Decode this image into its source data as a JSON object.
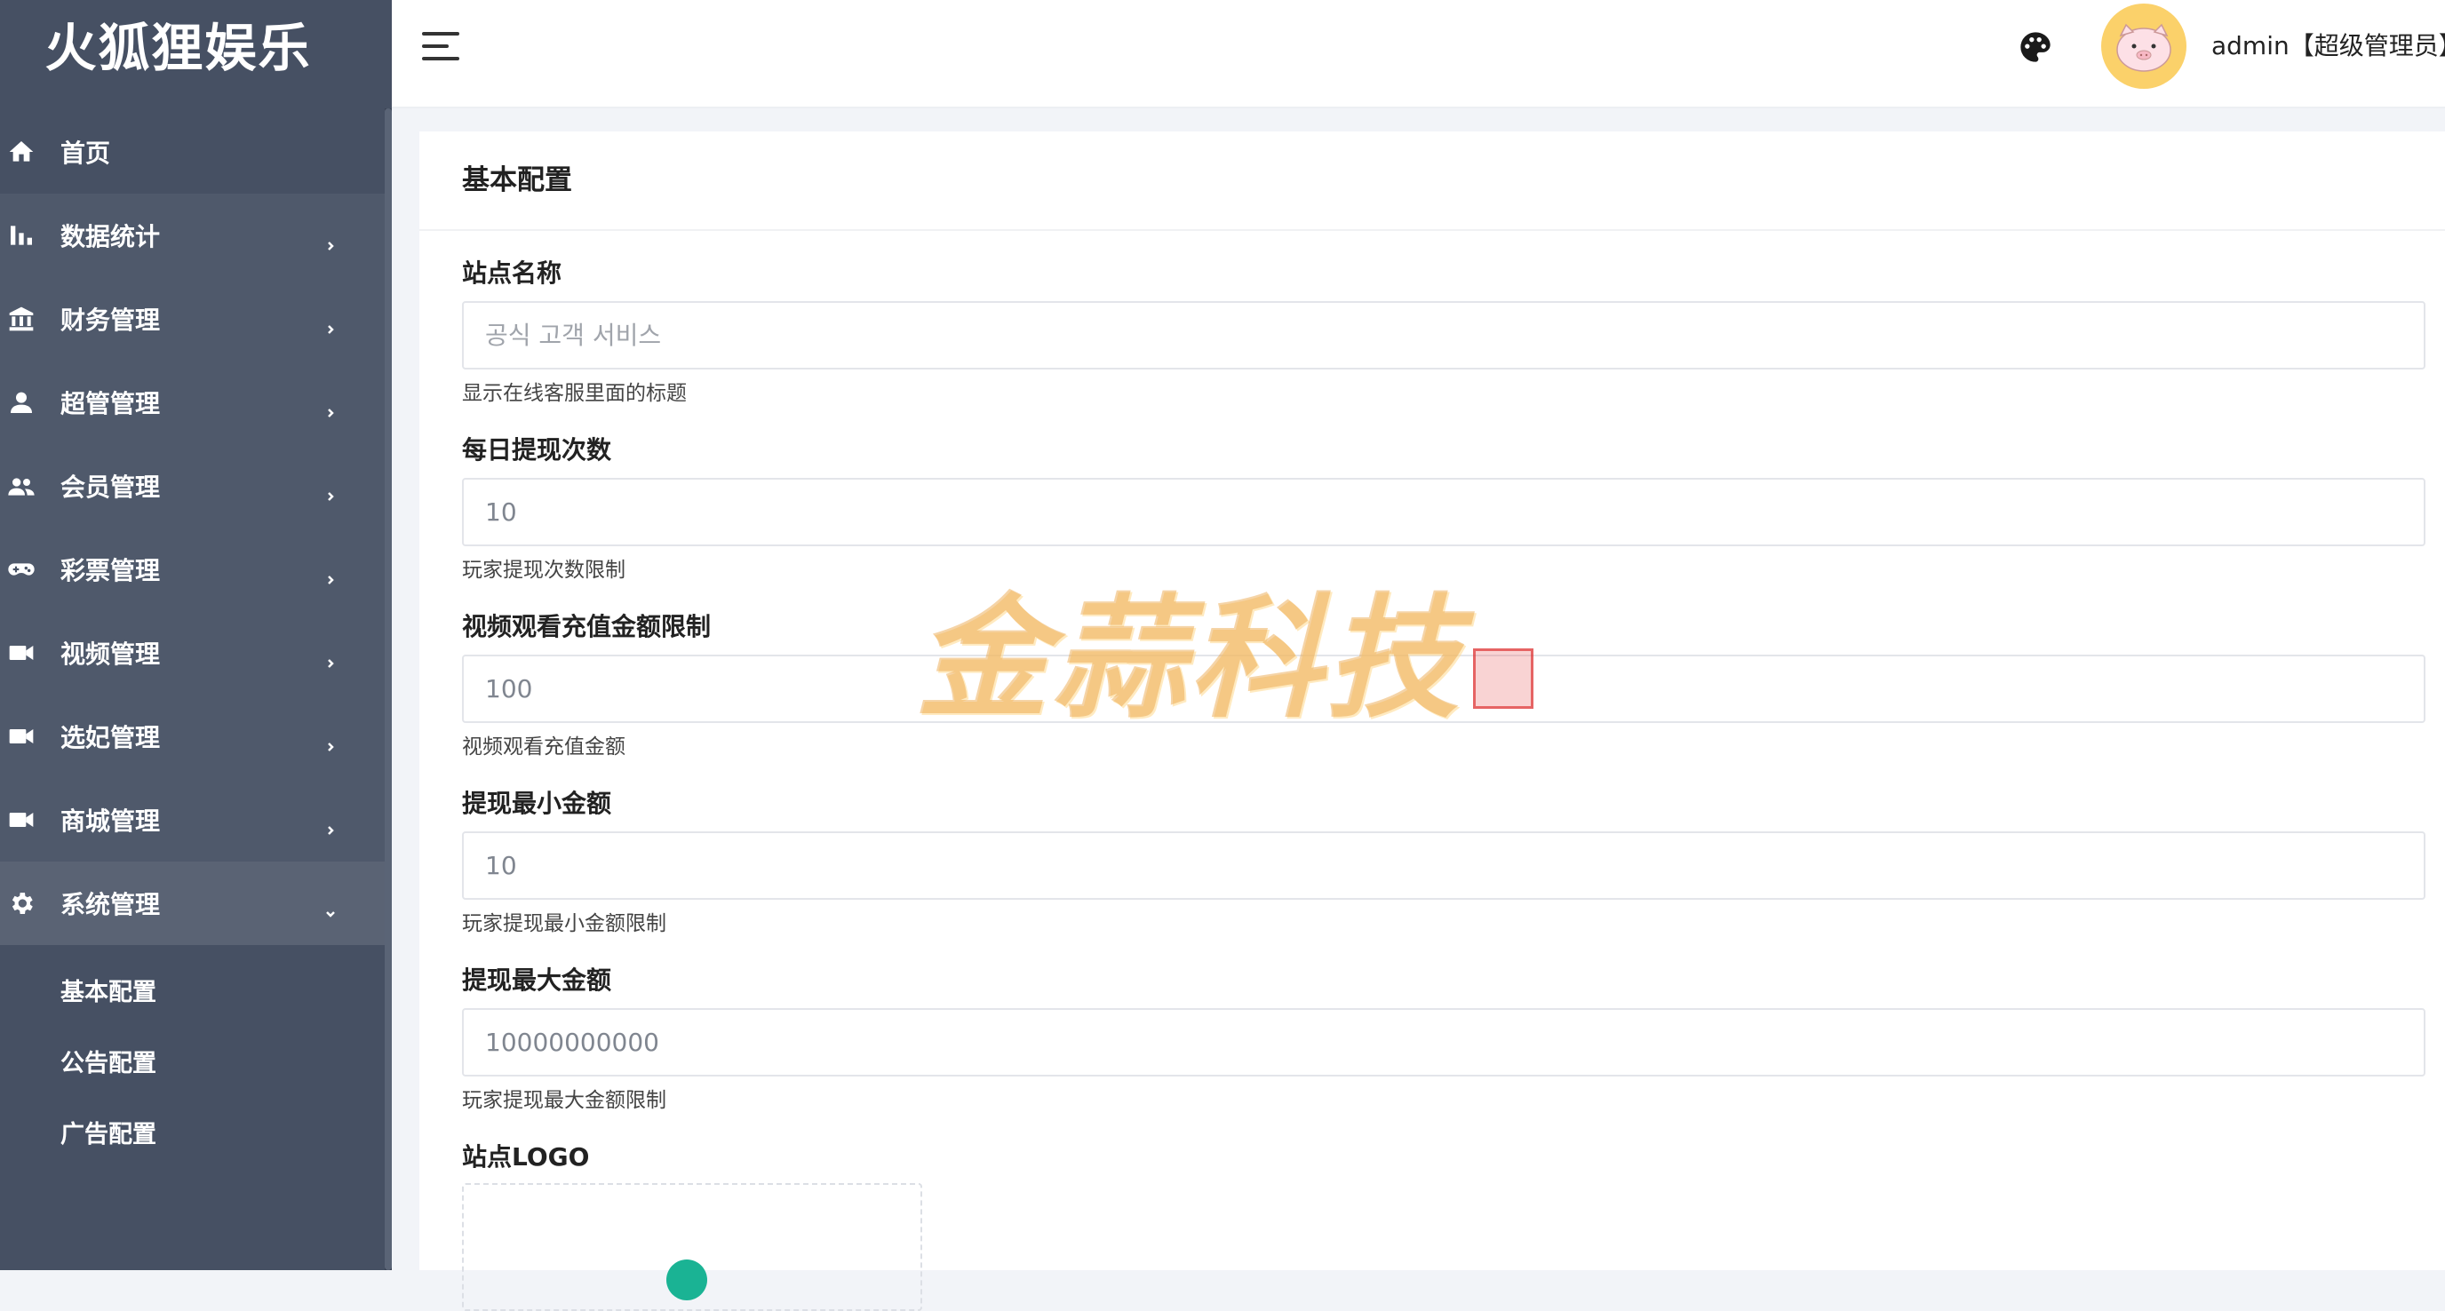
{
  "app": {
    "name": "火狐狸娱乐"
  },
  "sidebar": {
    "items": [
      {
        "label": "首页",
        "icon": "home-icon",
        "has_children": false
      },
      {
        "label": "数据统计",
        "icon": "bar-chart-icon",
        "has_children": true
      },
      {
        "label": "财务管理",
        "icon": "bank-icon",
        "has_children": true
      },
      {
        "label": "超管管理",
        "icon": "user-icon",
        "has_children": true
      },
      {
        "label": "会员管理",
        "icon": "users-icon",
        "has_children": true
      },
      {
        "label": "彩票管理",
        "icon": "gamepad-icon",
        "has_children": true
      },
      {
        "label": "视频管理",
        "icon": "video-icon",
        "has_children": true
      },
      {
        "label": "选妃管理",
        "icon": "video-icon",
        "has_children": true
      },
      {
        "label": "商城管理",
        "icon": "video-icon",
        "has_children": true
      },
      {
        "label": "系统管理",
        "icon": "gear-icon",
        "has_children": true,
        "expanded": true
      }
    ],
    "sub_items": [
      {
        "label": "基本配置"
      },
      {
        "label": "公告配置"
      },
      {
        "label": "广告配置"
      }
    ]
  },
  "header": {
    "user": "admin【超级管理员】",
    "icons": [
      "menu-icon",
      "palette-icon",
      "avatar"
    ]
  },
  "main": {
    "card_title": "基本配置",
    "fields": [
      {
        "label": "站点名称",
        "value": "",
        "placeholder": "공식 고객 서비스",
        "help": "显示在线客服里面的标题"
      },
      {
        "label": "每日提现次数",
        "value": "10",
        "placeholder": "",
        "help": "玩家提现次数限制"
      },
      {
        "label": "视频观看充值金额限制",
        "value": "100",
        "placeholder": "",
        "help": "视频观看充值金额"
      },
      {
        "label": "提现最小金额",
        "value": "10",
        "placeholder": "",
        "help": "玩家提现最小金额限制"
      },
      {
        "label": "提现最大金额",
        "value": "10000000000",
        "placeholder": "",
        "help": "玩家提现最大金额限制"
      }
    ],
    "logo_label": "站点LOGO"
  },
  "watermark": {
    "text": "金蒜科技"
  },
  "colors": {
    "sidebar_bg": "#465063",
    "accent": "#1ab394",
    "avatar_bg": "#fbd16a"
  }
}
